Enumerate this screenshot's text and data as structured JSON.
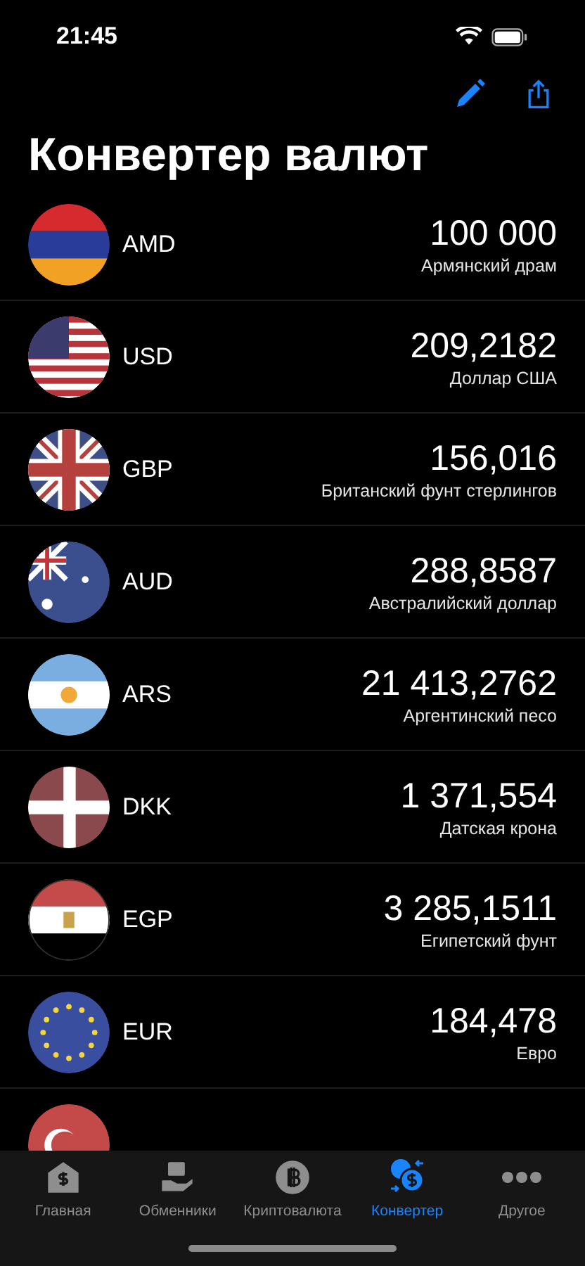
{
  "status_bar": {
    "time": "21:45"
  },
  "title": "Конвертер валют",
  "currencies": [
    {
      "kind": "am",
      "code": "AMD",
      "amount": "100 000",
      "name": "Армянский драм"
    },
    {
      "kind": "us",
      "code": "USD",
      "amount": "209,2182",
      "name": "Доллар США"
    },
    {
      "kind": "gb",
      "code": "GBP",
      "amount": "156,016",
      "name": "Британский фунт стерлингов"
    },
    {
      "kind": "au",
      "code": "AUD",
      "amount": "288,8587",
      "name": "Австралийский доллар"
    },
    {
      "kind": "ar",
      "code": "ARS",
      "amount": "21 413,2762",
      "name": "Аргентинский песо"
    },
    {
      "kind": "dk",
      "code": "DKK",
      "amount": "1 371,554",
      "name": "Датская крона"
    },
    {
      "kind": "eg",
      "code": "EGP",
      "amount": "3 285,1511",
      "name": "Египетский фунт"
    },
    {
      "kind": "eu",
      "code": "EUR",
      "amount": "184,478",
      "name": "Евро"
    },
    {
      "kind": "tr"
    }
  ],
  "tabs": [
    {
      "kind": "home",
      "label": "Главная",
      "selected": false
    },
    {
      "kind": "exchange",
      "label": "Обменники",
      "selected": false
    },
    {
      "kind": "crypto",
      "label": "Криптовалюта",
      "selected": false
    },
    {
      "kind": "converter",
      "label": "Конвертер",
      "selected": true
    },
    {
      "kind": "more",
      "label": "Другое",
      "selected": false
    }
  ]
}
